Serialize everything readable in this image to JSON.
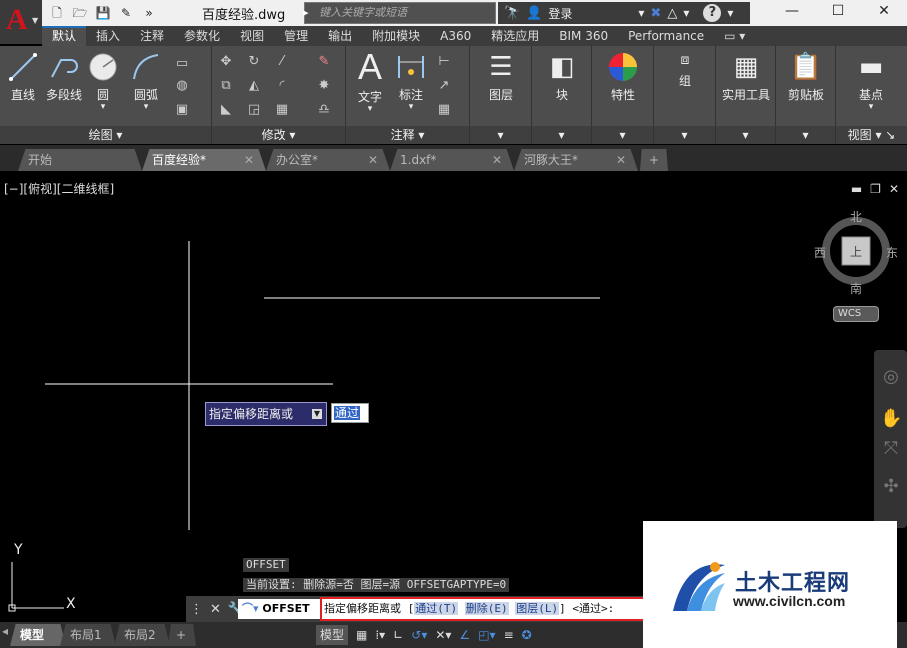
{
  "titlebar": {
    "document_title": "百度经验.dwg",
    "search_placeholder": "键入关键字或短语",
    "login_label": "登录",
    "minimize": "—",
    "maximize": "☐",
    "close": "✕"
  },
  "ribbon_tabs": [
    "默认",
    "插入",
    "注释",
    "参数化",
    "视图",
    "管理",
    "输出",
    "附加模块",
    "A360",
    "精选应用",
    "BIM 360",
    "Performance"
  ],
  "ribbon": {
    "draw": {
      "line": "直线",
      "polyline": "多段线",
      "circle": "圆",
      "arc": "圆弧",
      "footer": "绘图 ▾"
    },
    "modify": {
      "footer": "修改 ▾"
    },
    "annotation": {
      "text": "文字",
      "dimension": "标注",
      "footer": "注释 ▾"
    },
    "layers": {
      "label": "图层"
    },
    "block": {
      "label": "块"
    },
    "properties": {
      "label": "特性"
    },
    "group": {
      "label": "组"
    },
    "utilities": {
      "label": "实用工具"
    },
    "clipboard": {
      "label": "剪贴板"
    },
    "base": {
      "label": "基点"
    },
    "view": {
      "footer": "视图 ▾ ↘"
    }
  },
  "doc_tabs": [
    {
      "label": "开始"
    },
    {
      "label": "百度经验*"
    },
    {
      "label": "办公室*"
    },
    {
      "label": "1.dxf*"
    },
    {
      "label": "河豚大王*"
    }
  ],
  "viewport": {
    "label": "[−][俯视][二维线框]",
    "compass": {
      "north": "北",
      "south": "南",
      "east": "东",
      "west": "西",
      "top_face": "上"
    },
    "wcs": "WCS"
  },
  "dynamic_input": {
    "prompt": "指定偏移距离或",
    "value": "通过"
  },
  "command_history": {
    "line1": "OFFSET",
    "line2": "当前设置: 删除源=否  图层=源  OFFSETGAPTYPE=0"
  },
  "command_line": {
    "command": "OFFSET",
    "prefix": "指定偏移距离或 [",
    "opt1": "通过(T)",
    "opt2": "删除(E)",
    "opt3": "图层(L)",
    "suffix": "] <通过>:"
  },
  "layout_tabs": {
    "model": "模型",
    "layout1": "布局1",
    "layout2": "布局2"
  },
  "status": {
    "model_button": "模型"
  },
  "watermark": {
    "text": "土木工程网",
    "url": "www.civilcn.com"
  }
}
